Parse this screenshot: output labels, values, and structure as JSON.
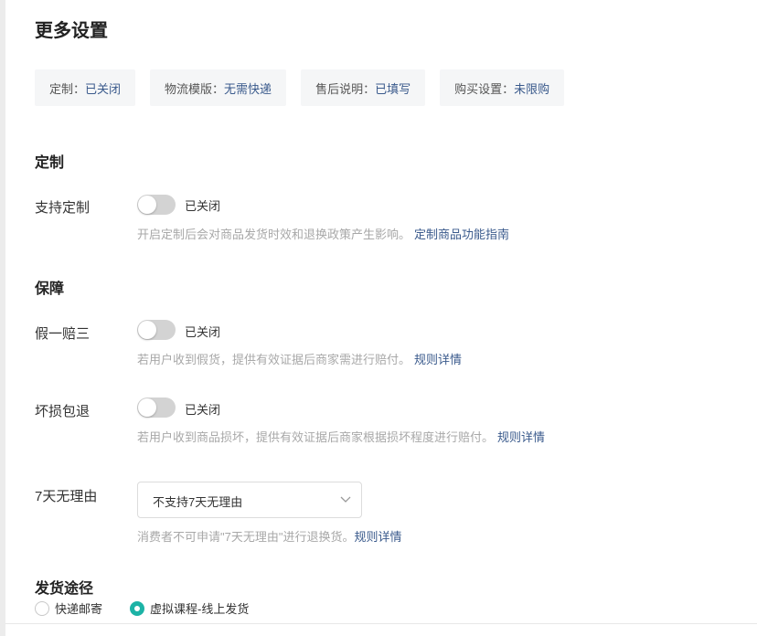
{
  "page": {
    "title": "更多设置"
  },
  "chips": [
    {
      "label": "定制：",
      "value": "已关闭"
    },
    {
      "label": "物流模版：",
      "value": "无需快递"
    },
    {
      "label": "售后说明：",
      "value": "已填写"
    },
    {
      "label": "购买设置：",
      "value": "未限购"
    }
  ],
  "custom": {
    "section_title": "定制",
    "label": "支持定制",
    "toggle_state": "已关闭",
    "hint": "开启定制后会对商品发货时效和退换政策产生影响。",
    "link": "定制商品功能指南"
  },
  "guarantee": {
    "section_title": "保障",
    "fake": {
      "label": "假一赔三",
      "toggle_state": "已关闭",
      "hint": "若用户收到假货，提供有效证据后商家需进行赔付。",
      "link": "规则详情"
    },
    "damage": {
      "label": "坏损包退",
      "toggle_state": "已关闭",
      "hint": "若用户收到商品损坏，提供有效证据后商家根据损坏程度进行赔付。",
      "link": "规则详情"
    },
    "seven_day": {
      "label": "7天无理由",
      "selected": "不支持7天无理由",
      "hint": "消费者不可申请\"7天无理由\"进行退换货。",
      "link": "规则详情"
    }
  },
  "delivery": {
    "section_title": "发货途径",
    "options": [
      {
        "label": "快递邮寄",
        "checked": false
      },
      {
        "label": "虚拟课程-线上发货",
        "checked": true
      }
    ]
  },
  "colors": {
    "accent": "#1cb3a6",
    "link": "#3a5a8c",
    "toggle_off": "#d3d3d3"
  },
  "icons": {
    "select_arrow": "chevron-down-icon"
  }
}
